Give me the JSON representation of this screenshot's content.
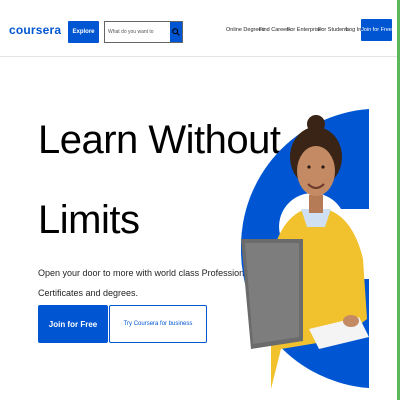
{
  "header": {
    "logo": "coursera",
    "explore_label": "Explore",
    "search_placeholder": "What do you want to",
    "nav": [
      "Online Degrees",
      "Find Careers",
      "For Enterprise",
      "For Students",
      "Log In"
    ],
    "join_label": "Join for Free"
  },
  "hero": {
    "title_line1": "Learn Without",
    "title_line2": "Limits",
    "subtitle_line1": "Open your door to more with world class Professional",
    "subtitle_line2": "Certificates and degrees.",
    "join_label": "Join for Free",
    "business_label": "Try Coursera for business"
  },
  "colors": {
    "brand": "#0056d2",
    "sweater": "#f2c12e"
  }
}
